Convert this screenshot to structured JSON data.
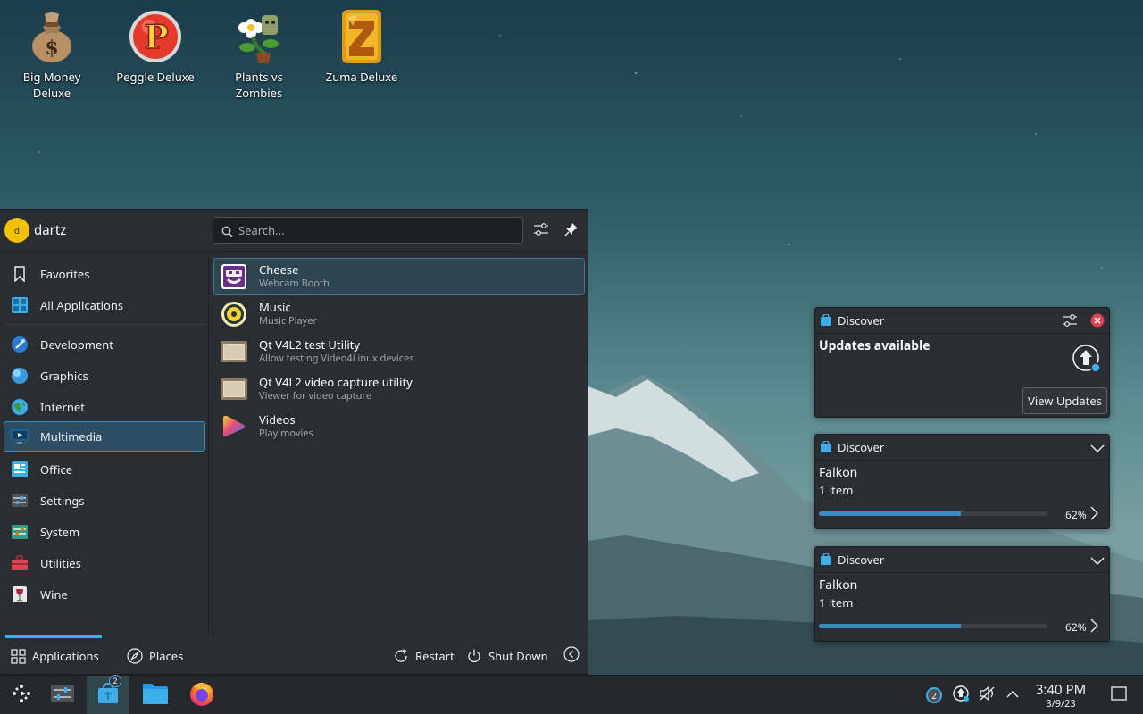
{
  "desktop": {
    "icons": [
      {
        "label": "Big Money Deluxe"
      },
      {
        "label": "Peggle Deluxe"
      },
      {
        "label": "Plants vs Zombies"
      },
      {
        "label": "Zuma Deluxe"
      }
    ]
  },
  "launcher": {
    "user": {
      "initial": "d",
      "name": "dartz"
    },
    "search": {
      "placeholder": "Search..."
    },
    "sidebar": {
      "items": [
        {
          "label": "Favorites"
        },
        {
          "label": "All Applications"
        },
        {
          "label": "Development"
        },
        {
          "label": "Graphics"
        },
        {
          "label": "Internet"
        },
        {
          "label": "Multimedia"
        },
        {
          "label": "Office"
        },
        {
          "label": "Settings"
        },
        {
          "label": "System"
        },
        {
          "label": "Utilities"
        },
        {
          "label": "Wine"
        }
      ],
      "selected": "Multimedia"
    },
    "apps": [
      {
        "name": "Cheese",
        "desc": "Webcam Booth"
      },
      {
        "name": "Music",
        "desc": "Music Player"
      },
      {
        "name": "Qt V4L2 test Utility",
        "desc": "Allow testing Video4Linux devices"
      },
      {
        "name": "Qt V4L2 video capture utility",
        "desc": "Viewer for video capture"
      },
      {
        "name": "Videos",
        "desc": "Play movies"
      }
    ],
    "footer": {
      "applications": "Applications",
      "places": "Places",
      "restart": "Restart",
      "shutdown": "Shut Down"
    }
  },
  "notifications": [
    {
      "app": "Discover",
      "title": "Updates available",
      "action": "View Updates"
    },
    {
      "app": "Discover",
      "title": "Falkon",
      "subtitle": "1 item",
      "progress": 62,
      "progress_label": "62%"
    },
    {
      "app": "Discover",
      "title": "Falkon",
      "subtitle": "1 item",
      "progress": 62,
      "progress_label": "62%"
    }
  ],
  "taskbar": {
    "discover_badge": "2",
    "tray_badge": "2",
    "time": "3:40 PM",
    "date": "3/9/23"
  },
  "colors": {
    "accent": "#3daee9",
    "panel": "#2a2e32",
    "taskbar": "#25292d",
    "selection": "#2d4d64"
  }
}
